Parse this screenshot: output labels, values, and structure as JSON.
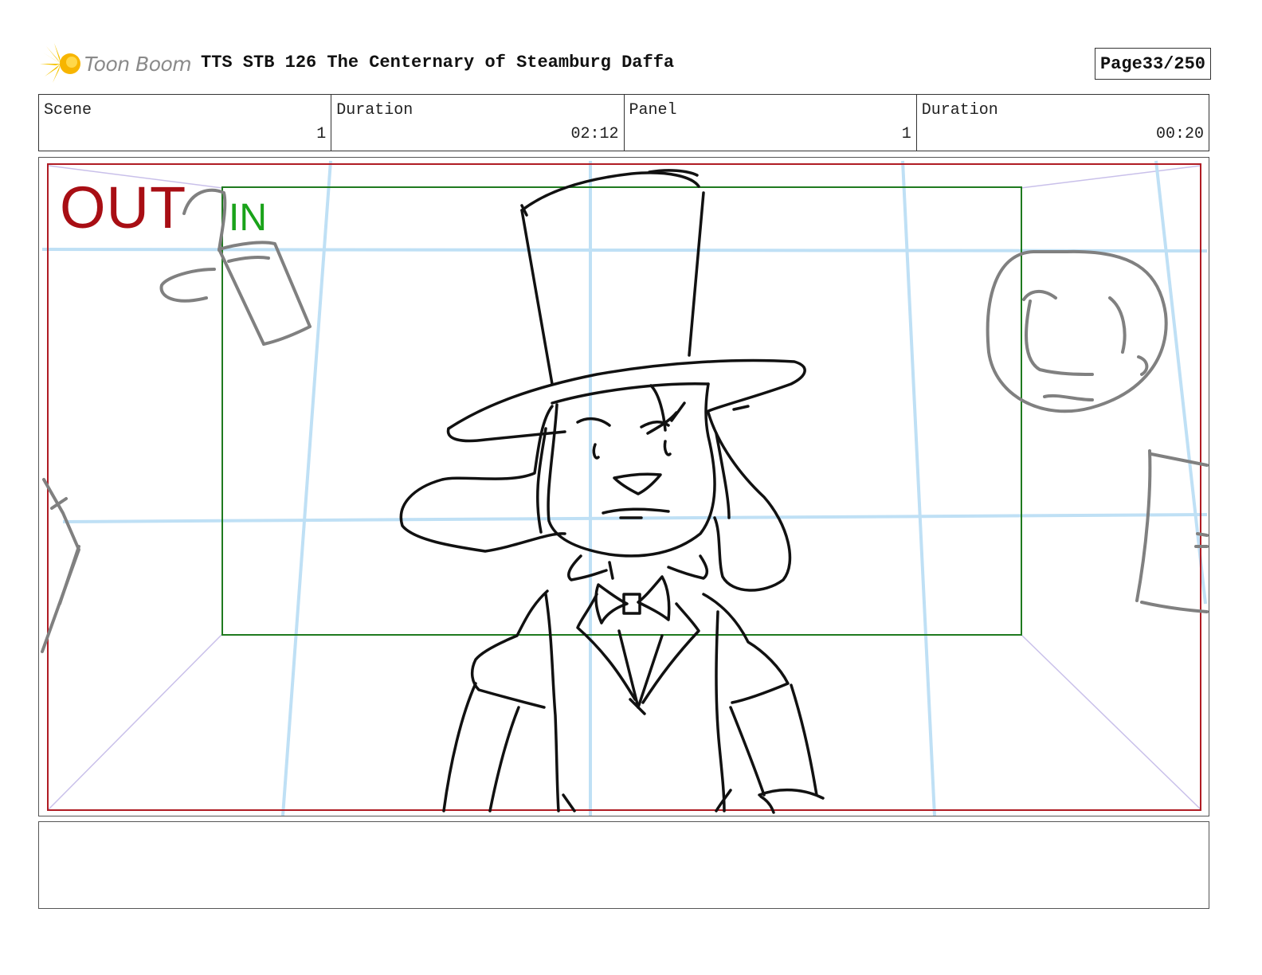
{
  "header": {
    "logo_text": "Toon Boom",
    "title": "TTS STB 126 The Centernary of Steamburg Daffa",
    "page_label": "Page",
    "page_value": "33/250"
  },
  "info": {
    "scene_label": "Scene",
    "scene_value": "1",
    "scene_duration_label": "Duration",
    "scene_duration_value": "02:12",
    "panel_label": "Panel",
    "panel_value": "1",
    "panel_duration_label": "Duration",
    "panel_duration_value": "00:20"
  },
  "panel": {
    "out_label": "OUT",
    "in_label": "IN",
    "colors": {
      "out_frame": "#b01c24",
      "in_frame": "#1f7a1f",
      "grid": "#bfe0f5",
      "perspective": "#c9c0ea",
      "sketch": "#111111",
      "props": "#808080"
    }
  },
  "icons": {
    "logo": "toon-boom-starburst-icon"
  }
}
